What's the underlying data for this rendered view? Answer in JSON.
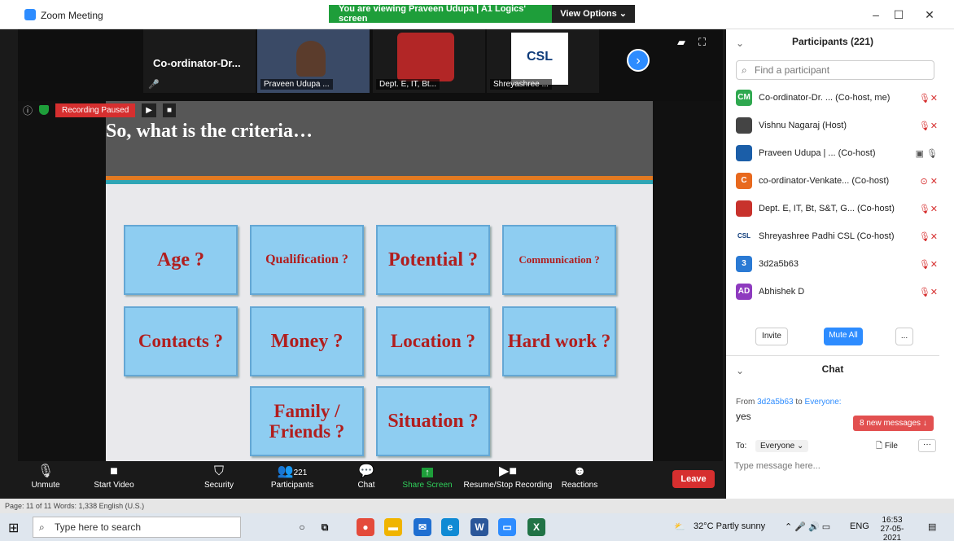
{
  "window": {
    "title": "Zoom Meeting",
    "banner": "You are viewing Praveen Udupa | A1 Logics' screen",
    "view_options": "View Options ⌄",
    "minimize": "–",
    "maximize": "☐",
    "close": "✕"
  },
  "strip": {
    "tile1_name": "Co-ordinator-Dr...",
    "tile2_name": "Praveen Udupa ...",
    "tile3_name": "Dept. E, IT, Bt...",
    "tile4_name": "Shreyashree ...",
    "next": "›"
  },
  "recording": {
    "label": "Recording Paused",
    "play": "▶",
    "stop": "■"
  },
  "slide": {
    "title": "So, what is the criteria…",
    "boxes": [
      "Age ?",
      "Qualification ?",
      "Potential ?",
      "Communication ?",
      "Contacts ?",
      "Money ?",
      "Location ?",
      "Hard work ?",
      "Family / Friends ?",
      "Situation ?"
    ]
  },
  "toolbar": {
    "unmute": "Unmute",
    "start_video": "Start Video",
    "security": "Security",
    "participants": "Participants",
    "participants_count": "221",
    "chat": "Chat",
    "share_screen": "Share Screen",
    "recording": "Resume/Stop Recording",
    "reactions": "Reactions",
    "leave": "Leave"
  },
  "panel": {
    "title": "Participants (221)",
    "search_placeholder": "Find a participant",
    "participants": [
      {
        "initials": "CM",
        "name": "Co-ordinator-Dr. ... (Co-host, me)",
        "color": "#2fa84f"
      },
      {
        "initials": "",
        "name": "Vishnu Nagaraj (Host)",
        "color": "#444444"
      },
      {
        "initials": "",
        "name": "Praveen Udupa | ... (Co-host)",
        "color": "#1b5ea8"
      },
      {
        "initials": "C",
        "name": "co-ordinator-Venkate... (Co-host)",
        "color": "#e8691e"
      },
      {
        "initials": "",
        "name": "Dept. E, IT, Bt, S&T, G... (Co-host)",
        "color": "#c8322c"
      },
      {
        "initials": "CSL",
        "name": "Shreyashree Padhi CSL (Co-host)",
        "color": "#ffffff"
      },
      {
        "initials": "3",
        "name": "3d2a5b63",
        "color": "#2a7ad4"
      },
      {
        "initials": "AD",
        "name": "Abhishek D",
        "color": "#8e3bbf"
      }
    ],
    "invite": "Invite",
    "mute_all": "Mute All",
    "more": "...",
    "chat_title": "Chat",
    "chat_from": "From",
    "chat_sender": "3d2a5b63",
    "chat_to_word": "to",
    "chat_recipient": "Everyone:",
    "chat_message": "yes",
    "new_messages": "8 new messages ↓",
    "to_label": "To:",
    "to_value": "Everyone ⌄",
    "file": "File",
    "input_placeholder": "Type message here..."
  },
  "wordbar": {
    "status": "Page: 11 of 11   Words: 1,338      English (U.S.)"
  },
  "taskbar": {
    "search_placeholder": "Type here to search",
    "weather": "32°C  Partly sunny",
    "lang": "ENG",
    "time": "16:53",
    "date": "27-05-2021"
  }
}
